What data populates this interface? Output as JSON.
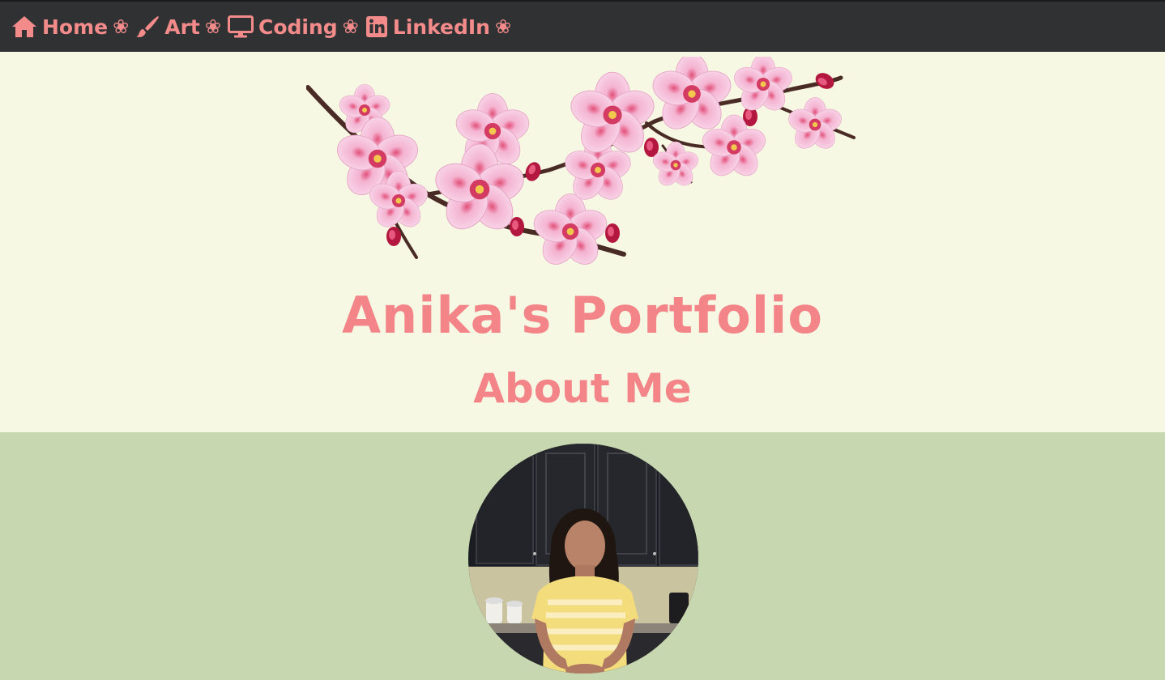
{
  "nav": {
    "items": [
      {
        "label": "Home",
        "icon": "home-icon"
      },
      {
        "label": "Art",
        "icon": "paintbrush-icon"
      },
      {
        "label": "Coding",
        "icon": "desktop-icon"
      },
      {
        "label": "LinkedIn",
        "icon": "linkedin-icon"
      }
    ],
    "separator": "❀"
  },
  "header": {
    "title": "Anika's Portfolio",
    "subtitle": "About Me"
  },
  "colors": {
    "accent": "#f38b8b",
    "nav_background": "#2f3133",
    "hero_background": "#f7f8e3",
    "about_background": "#c7d7af"
  }
}
